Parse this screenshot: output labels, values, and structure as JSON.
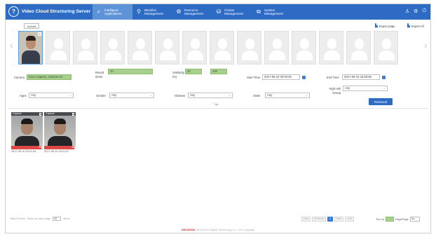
{
  "app": {
    "title": "Video Cloud Structuring Server",
    "logo_glyph": "?"
  },
  "nav": [
    {
      "label": "Intelligent Applications",
      "icon": "search-icon",
      "glyph": "⌕",
      "active": true
    },
    {
      "label": "Blacklist Management",
      "icon": "person-icon",
      "glyph": "⚲",
      "active": false
    },
    {
      "label": "Resource Management",
      "icon": "gear-icon",
      "glyph": "⚙",
      "active": false
    },
    {
      "label": "Cluster Management",
      "icon": "cluster-icon",
      "glyph": "⛁",
      "active": false
    },
    {
      "label": "System Management",
      "icon": "system-icon",
      "glyph": "⧉",
      "active": false
    }
  ],
  "top_icons": [
    {
      "name": "user-icon",
      "glyph": "♙"
    },
    {
      "name": "settings-icon",
      "glyph": "⚙"
    },
    {
      "name": "logout-icon",
      "glyph": "⏻"
    }
  ],
  "toolbar": {
    "upload_label": "Upload",
    "export_page_label": "Export page",
    "export_all_label": "Export All"
  },
  "filters": {
    "camera_label": "Camera",
    "camera_value": "Face Capture_Camera 01",
    "result_items_label": "Result Items",
    "result_items_value": "10",
    "similarity_label": "Similarity (%)",
    "similarity_min": "20",
    "similarity_max": "100",
    "start_time_label": "Start Time",
    "start_time_value": "2017-05-10 00:00:00",
    "end_time_label": "End Time",
    "end_time_value": "2017-05-10 23:59:59",
    "ages_label": "Ages",
    "ages_value": "Any",
    "gender_label": "Gender",
    "gender_value": "Any",
    "glasses_label": "Glasses",
    "glasses_value": "Any",
    "smile_label": "Smile",
    "smile_value": "Any",
    "high_risk_label": "High-risk Group",
    "high_risk_value": "Any",
    "expand_label": "Up",
    "retrieval_label": "Retrieval"
  },
  "results": [
    {
      "top_text": "Capture",
      "similarity_text": "96",
      "similarity": 0.96,
      "time": "2017-05-10 09:21:34"
    },
    {
      "top_text": "Capture",
      "similarity_text": "96",
      "similarity": 0.96,
      "time": "2017-05-10 09:11:57"
    }
  ],
  "pagination": {
    "total_label": "Total 2 Items",
    "per_page_label": "Show on each page",
    "per_page_value": "20",
    "items_label": "Items",
    "first_label": "First",
    "prev_label": "Previous",
    "current_page": "1",
    "next_label": "Next",
    "last_label": "Last",
    "turn_to_label": "Turn to",
    "page_label": "Page/Page",
    "go_label": "Go"
  },
  "footer": {
    "brand": "HIKVISION",
    "company": "HIKVISION Digital Technology Co., Ltd. Copyright"
  },
  "colors": {
    "nav_bg": "#2d6bc4",
    "nav_active": "#5f93d8",
    "field_green": "#a8d08d",
    "score_red": "#e04848"
  }
}
